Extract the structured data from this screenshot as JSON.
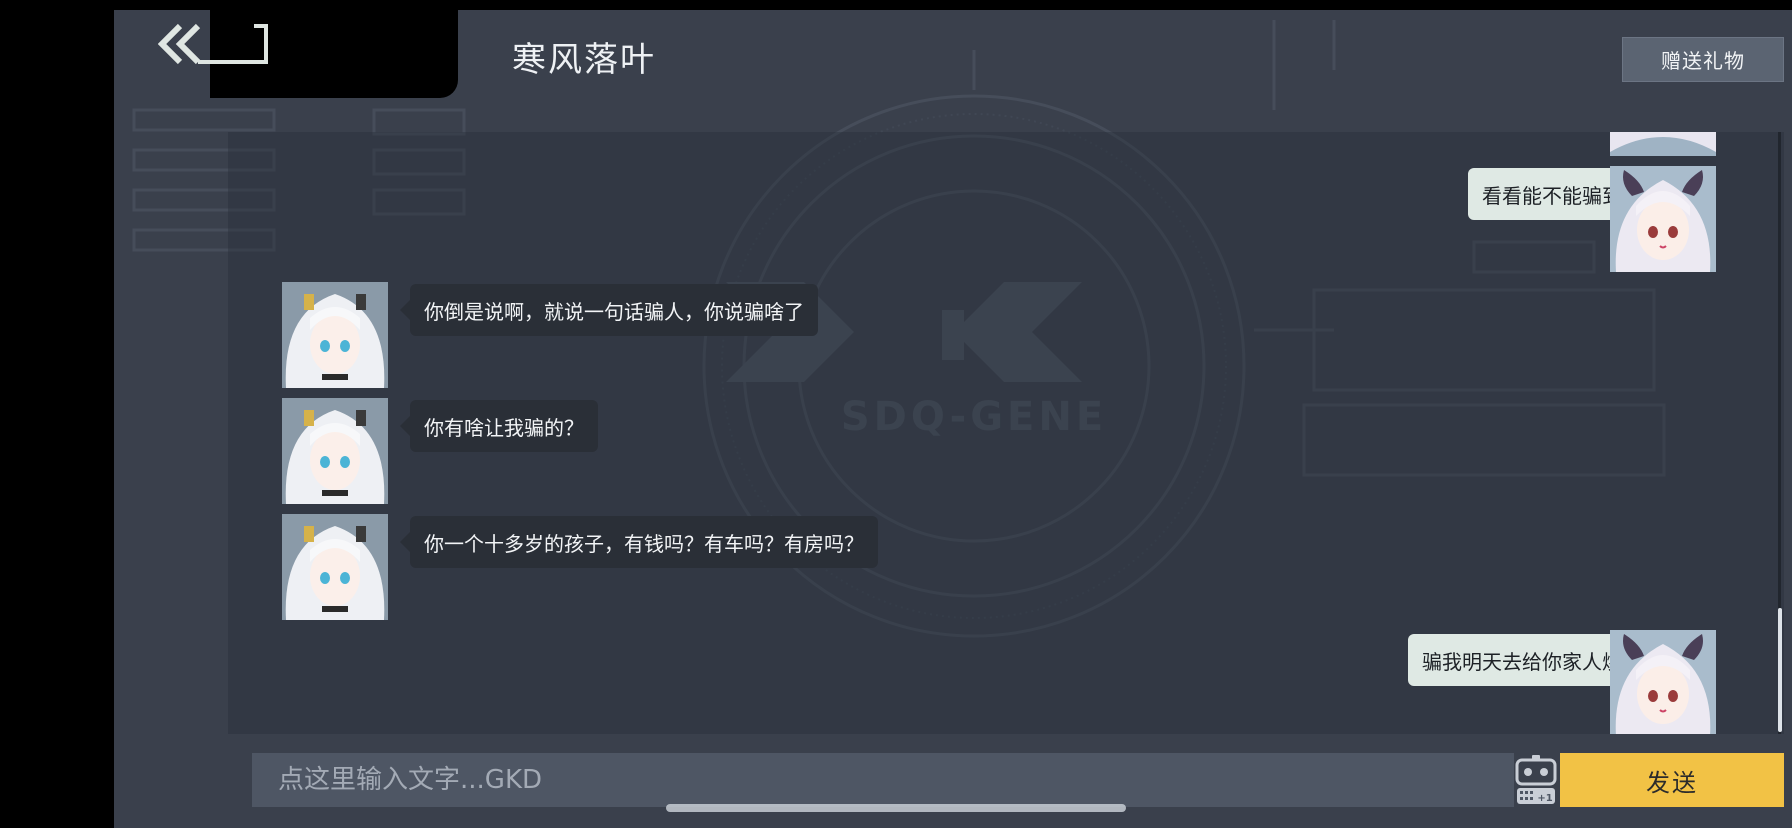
{
  "header": {
    "title": "寒风落叶",
    "gift_button": "赠送礼物",
    "back_icon": "double-chevron-left-icon"
  },
  "background": {
    "logo_text": "SDQ-GENE"
  },
  "messages": [
    {
      "side": "left",
      "text": "你倒是说啊，就说一句话骗人，你说骗啥了"
    },
    {
      "side": "left",
      "text": "你有啥让我骗的？"
    },
    {
      "side": "left",
      "text": "你一个十多岁的孩子，有钱吗？有车吗？有房吗？"
    },
    {
      "side": "right",
      "text": "看看能不能骗到人"
    },
    {
      "side": "right",
      "text": "骗我明天去给你家人烧纸"
    }
  ],
  "composer": {
    "placeholder": "点这里输入文字...GKD",
    "send_label": "发送",
    "robot_badge": "+1",
    "robot_icon": "robot-keyboard-icon"
  },
  "colors": {
    "accent": "#f2c245",
    "background": "#3a404c",
    "bubble_left": "#2a2f37",
    "bubble_right": "#dfe9e4"
  }
}
